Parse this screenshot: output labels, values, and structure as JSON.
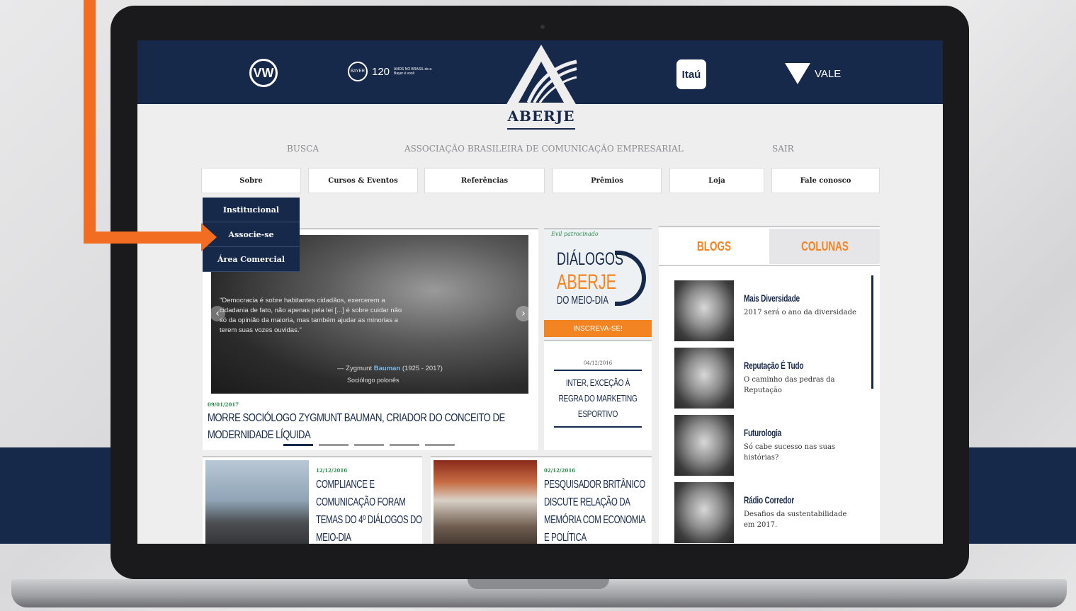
{
  "sponsors": {
    "vw": "VW",
    "bayer_small": "BAYER",
    "bayer_120": "120",
    "bayer_tagline": "ANOS NO BRASIL de a Bayer é você",
    "itau": "Itaú",
    "vale": "VALE"
  },
  "site": {
    "logo_text": "ABERJE",
    "search_label": "BUSCA",
    "tagline": "ASSOCIAÇÃO BRASILEIRA DE COMUNICAÇÃO EMPRESARIAL",
    "logout_label": "SAIR"
  },
  "nav": {
    "items": [
      "Sobre",
      "Cursos & Eventos",
      "Referências",
      "Prêmios",
      "Loja",
      "Fale conosco"
    ],
    "dropdown": [
      "Institucional",
      "Associe-se",
      "Área Comercial"
    ]
  },
  "slider": {
    "quote": "\"Democracia é sobre habitantes cidadãos, exercerem a cidadania de fato, não apenas pela lei [...] é sobre cuidar não só da opinião da maioria, mas também ajudar as minorias a terem suas vozes ouvidas.\"",
    "author_prefix": "— Zygmunt",
    "author_name": "Bauman",
    "author_years": "(1925 - 2017)",
    "author_role": "Sociólogo polonês",
    "date": "09/01/2017",
    "title": "MORRE SOCIÓLOGO ZYGMUNT BAUMAN, CRIADOR DO CONCEITO DE MODERNIDADE LÍQUIDA",
    "prev_icon": "‹",
    "next_icon": "›"
  },
  "promo": {
    "subtitle": "Evil patrocinado",
    "line1": "DIÁLOGOS",
    "line2": "ABERJE",
    "line3": "DO MEIO-DIA",
    "button": "INSCREVA-SE!"
  },
  "news_card": {
    "date": "04/12/2016",
    "title": "INTER, EXCEÇÃO À REGRA DO MARKETING ESPORTIVO"
  },
  "cards": [
    {
      "date": "12/12/2016",
      "title": "COMPLIANCE E COMUNICAÇÃO FORAM TEMAS DO 4º DIÁLOGOS DO MEIO-DIA"
    },
    {
      "date": "02/12/2016",
      "title": "PESQUISADOR BRITÂNICO DISCUTE RELAÇÃO DA MEMÓRIA COM ECONOMIA E POLÍTICA"
    }
  ],
  "sidebar": {
    "tabs": [
      "BLOGS",
      "COLUNAS"
    ],
    "blogs": [
      {
        "title": "Mais Diversidade",
        "desc": "2017 será o ano da diversidade"
      },
      {
        "title": "Reputação É Tudo",
        "desc": "O caminho das pedras da Reputação"
      },
      {
        "title": "Futurologia",
        "desc": "Só cabe sucesso nas suas histórias?"
      },
      {
        "title": "Rádio Corredor",
        "desc": "Desafios da sustentabilidade em 2017."
      }
    ]
  },
  "colors": {
    "navy": "#17294b",
    "orange": "#f28522",
    "callout_orange": "#f26d21",
    "green_date": "#2a8a4e"
  }
}
